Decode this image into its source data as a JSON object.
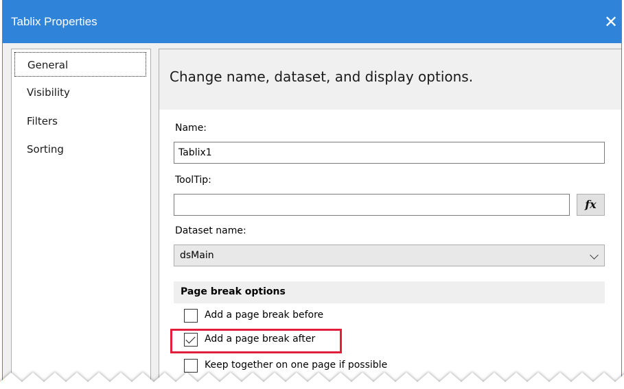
{
  "window": {
    "title": "Tablix Properties",
    "close_glyph": "✕"
  },
  "sidebar": {
    "items": [
      {
        "label": "General",
        "selected": true
      },
      {
        "label": "Visibility",
        "selected": false
      },
      {
        "label": "Filters",
        "selected": false
      },
      {
        "label": "Sorting",
        "selected": false
      }
    ]
  },
  "content": {
    "header": "Change name, dataset, and display options.",
    "name": {
      "label": "Name:",
      "value": "Tablix1"
    },
    "tooltip": {
      "label": "ToolTip:",
      "value": "",
      "fx_label": "fx"
    },
    "dataset": {
      "label": "Dataset name:",
      "value": "dsMain"
    },
    "page_break": {
      "title": "Page break options",
      "options": [
        {
          "label": "Add a page break before",
          "checked": false
        },
        {
          "label": "Add a page break after",
          "checked": true
        },
        {
          "label": "Keep together on one page if possible",
          "checked": false
        }
      ]
    }
  },
  "colors": {
    "titlebar": "#2f84d9",
    "highlight": "#e21e3a"
  }
}
